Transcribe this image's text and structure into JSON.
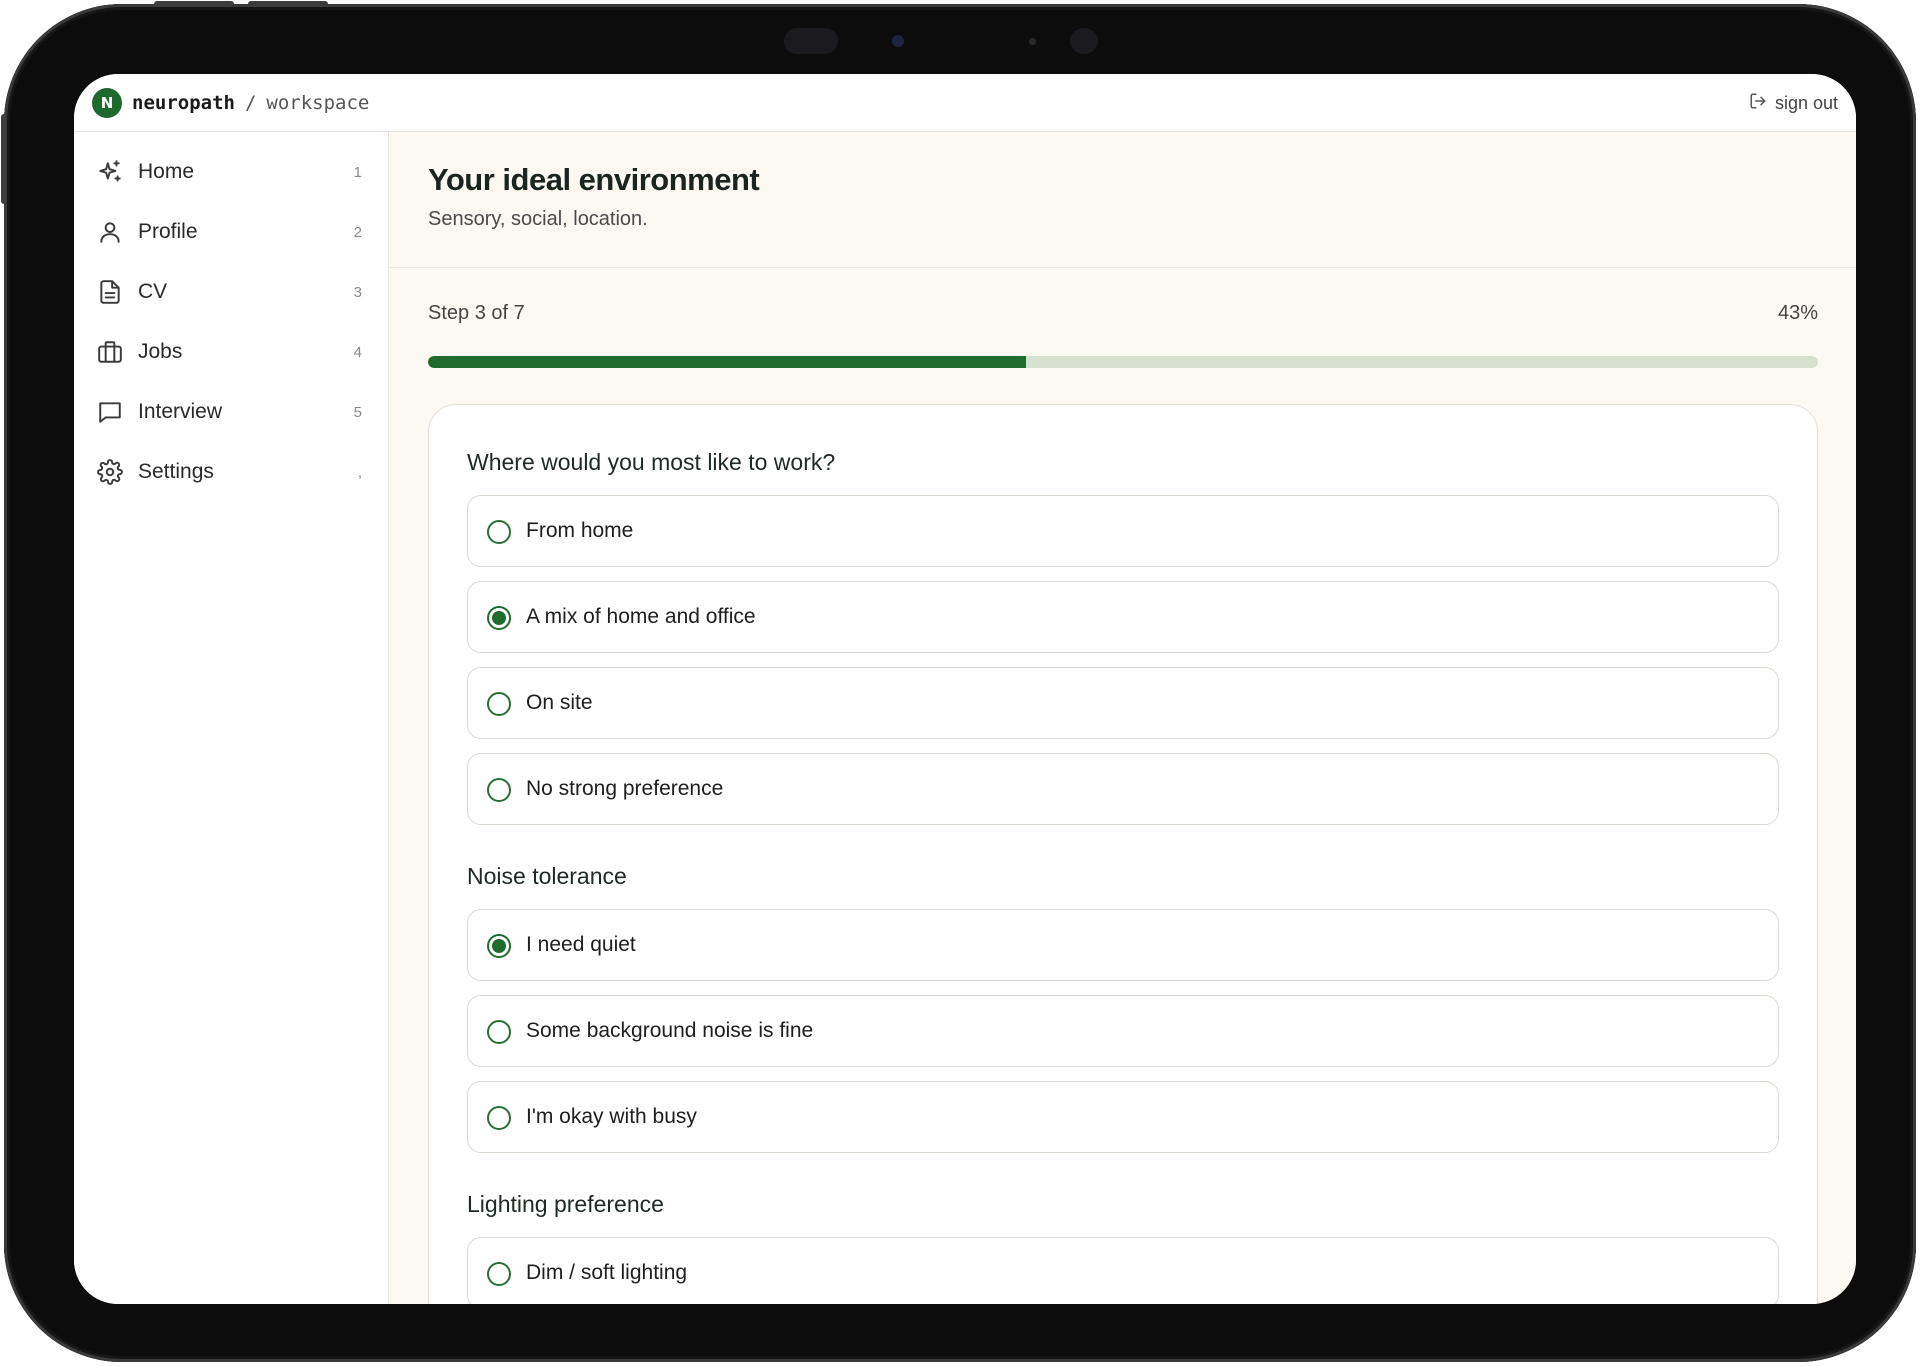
{
  "app": {
    "logo_letter": "N",
    "brand": "neuropath",
    "separator": "/",
    "section": "workspace",
    "sign_out_label": "sign out",
    "accent_color": "#1f6c2e"
  },
  "sidebar": {
    "items": [
      {
        "label": "Home",
        "key": "1",
        "icon": "sparkles-icon"
      },
      {
        "label": "Profile",
        "key": "2",
        "icon": "user-icon"
      },
      {
        "label": "CV",
        "key": "3",
        "icon": "document-icon"
      },
      {
        "label": "Jobs",
        "key": "4",
        "icon": "briefcase-icon"
      },
      {
        "label": "Interview",
        "key": "5",
        "icon": "chat-icon"
      },
      {
        "label": "Settings",
        "key": ",",
        "icon": "gear-icon"
      }
    ]
  },
  "page": {
    "title": "Your ideal environment",
    "subtitle": "Sensory, social, location."
  },
  "progress": {
    "step_text": "Step 3 of 7",
    "percent_text": "43%",
    "fraction": 0.43
  },
  "questions": [
    {
      "title": "Where would you most like to work?",
      "options": [
        {
          "label": "From home",
          "selected": false
        },
        {
          "label": "A mix of home and office",
          "selected": true
        },
        {
          "label": "On site",
          "selected": false
        },
        {
          "label": "No strong preference",
          "selected": false
        }
      ]
    },
    {
      "title": "Noise tolerance",
      "options": [
        {
          "label": "I need quiet",
          "selected": true
        },
        {
          "label": "Some background noise is fine",
          "selected": false
        },
        {
          "label": "I'm okay with busy",
          "selected": false
        }
      ]
    },
    {
      "title": "Lighting preference",
      "options": [
        {
          "label": "Dim / soft lighting",
          "selected": false
        }
      ]
    }
  ]
}
